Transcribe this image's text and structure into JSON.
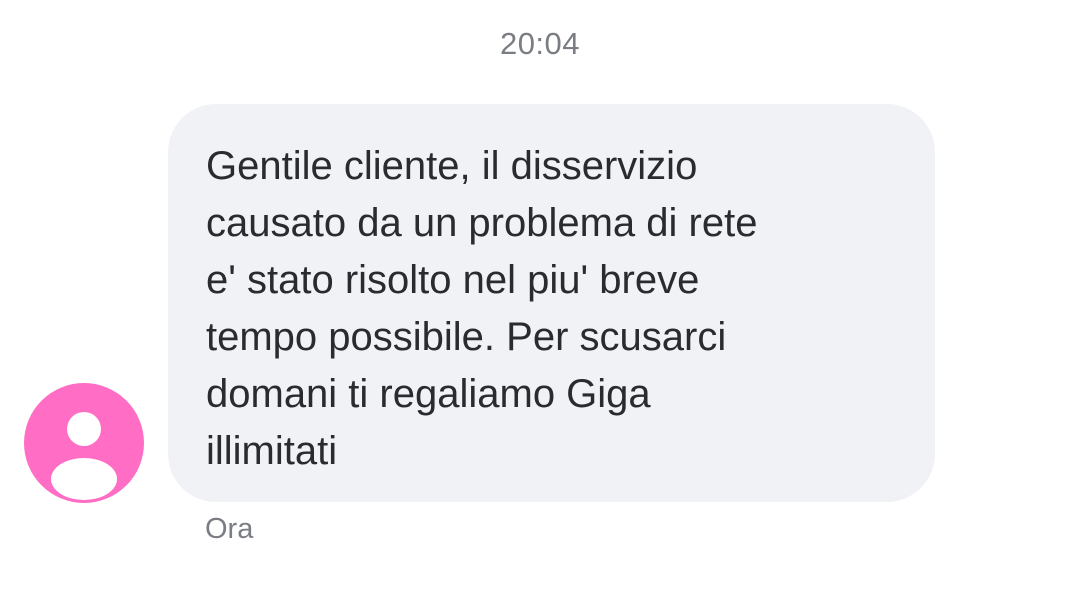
{
  "conversation": {
    "timestamp": "20:04",
    "message": {
      "text": "Gentile cliente, il disservizio\ncausato da un problema di rete\ne' stato risolto nel piu' breve\ntempo possibile. Per scusarci\ndomani ti regaliamo Giga\nillimitati",
      "status": "Ora"
    },
    "sender": {
      "avatar_icon": "person-icon",
      "avatar_color": "#ff6ec4"
    },
    "bubble_color": "#f1f2f6"
  }
}
